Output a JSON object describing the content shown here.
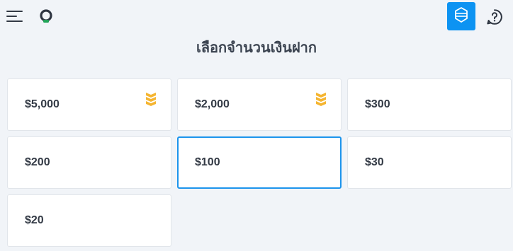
{
  "header": {
    "menu_icon": "hamburger-menu-icon",
    "logo_icon": "ring-logo-icon",
    "shield_icon": "shield-icon",
    "help_icon": "question-circle-icon",
    "accent_color": "#0d93f2"
  },
  "page": {
    "title": "เลือกจำนวนเงินฝาก"
  },
  "amounts": [
    {
      "label": "$5,000",
      "badge_icon": "chevron-rank-icon",
      "selected": false
    },
    {
      "label": "$2,000",
      "badge_icon": "chevron-rank-icon",
      "selected": false
    },
    {
      "label": "$300",
      "selected": false
    },
    {
      "label": "$200",
      "selected": false
    },
    {
      "label": "$100",
      "selected": true
    },
    {
      "label": "$30",
      "selected": false
    },
    {
      "label": "$20",
      "selected": false
    }
  ],
  "colors": {
    "background": "#f1f4f8",
    "selected_border": "#1c94ec",
    "badge": "#f5b531"
  }
}
